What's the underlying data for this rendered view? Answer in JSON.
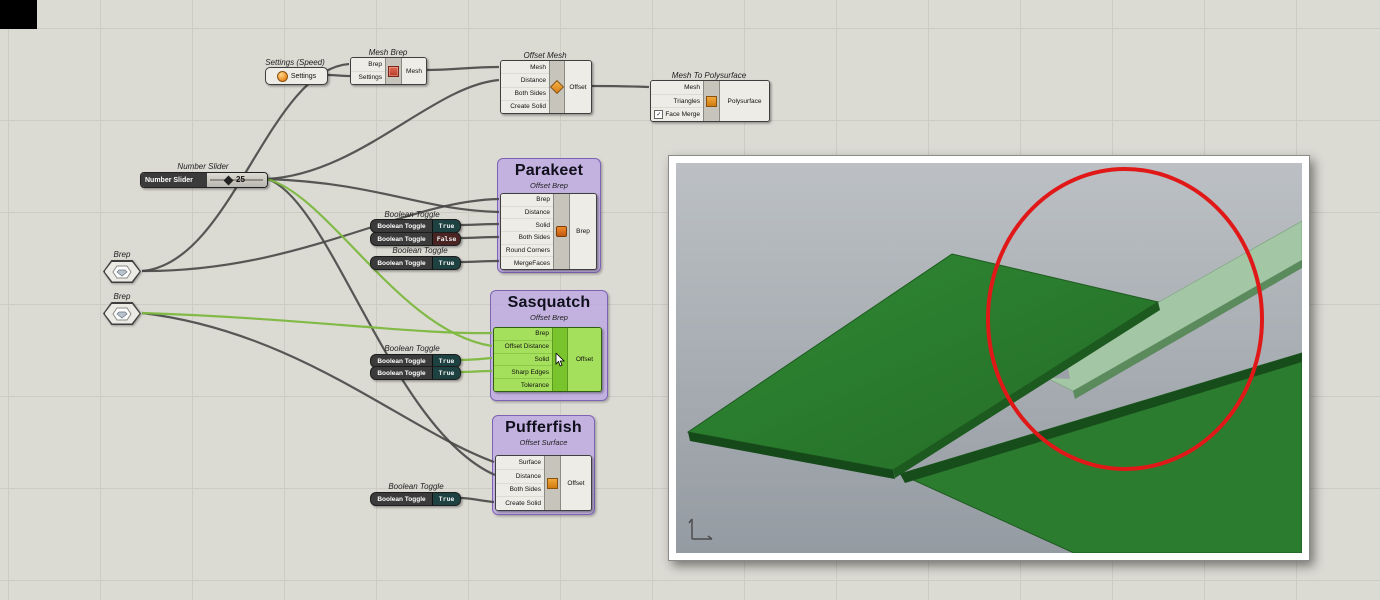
{
  "params": {
    "settings": {
      "label": "Settings (Speed)",
      "name": "Settings"
    },
    "slider": {
      "label": "Number Slider",
      "name": "Number Slider",
      "value": "25"
    },
    "brep1": {
      "label": "Brep"
    },
    "brep2": {
      "label": "Brep"
    },
    "toggle": {
      "label": "Boolean Toggle",
      "name": "Boolean Toggle"
    },
    "toggle_values": {
      "t1": "True",
      "t2": "False",
      "t3": "True",
      "t4": "True",
      "t5": "True",
      "t6": "True"
    }
  },
  "components": {
    "mesh_brep": {
      "label": "Mesh Brep",
      "inputs": [
        "Brep",
        "Settings"
      ],
      "output": "Mesh"
    },
    "offset_mesh": {
      "label": "Offset Mesh",
      "inputs": [
        "Mesh",
        "Distance",
        "Both Sides",
        "Create Solid"
      ],
      "output": "Offset"
    },
    "mesh_to_polysurface": {
      "label": "Mesh To Polysurface",
      "inputs": [
        "Mesh",
        "Triangles",
        "Face Merge"
      ],
      "output": "Polysurface"
    }
  },
  "groups": {
    "parakeet": {
      "title": "Parakeet",
      "subtitle": "Offset Brep",
      "inputs": [
        "Brep",
        "Distance",
        "Solid",
        "Both Sides",
        "Round Corners",
        "MergeFaces"
      ],
      "output": "Brep"
    },
    "sasquatch": {
      "title": "Sasquatch",
      "subtitle": "Offset Brep",
      "inputs": [
        "Brep",
        "Offset Distance",
        "Solid",
        "Sharp Edges",
        "Tolerance"
      ],
      "output": "Offset"
    },
    "pufferfish": {
      "title": "Pufferfish",
      "subtitle": "Offset Surface",
      "inputs": [
        "Surface",
        "Distance",
        "Both Sides",
        "Create Solid"
      ],
      "output": "Offset"
    }
  },
  "colors": {
    "selection_green": "#79c32c",
    "group_purple": "#bda8e2",
    "wire_gray": "#474747",
    "wire_green": "#7cb83e",
    "annotation_red": "#e11818",
    "model_green": "#2a7e2e",
    "viewport_gray": "#a7adb3"
  }
}
